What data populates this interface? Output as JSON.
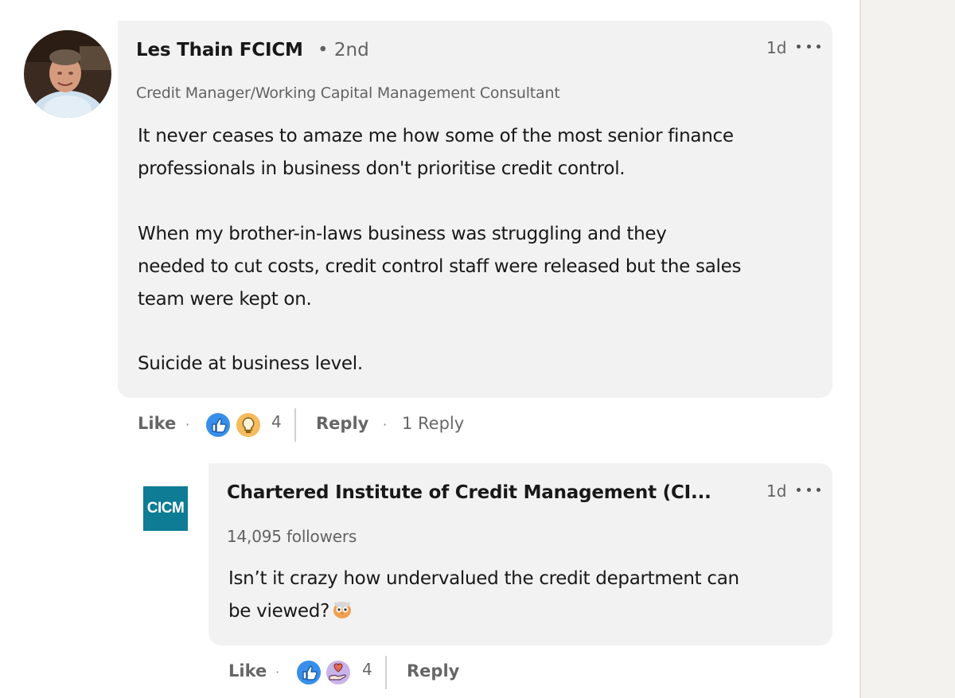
{
  "comment": {
    "author": "Les Thain FCICM",
    "degree": "• 2nd",
    "headline": "Credit Manager/Working Capital Management Consultant",
    "time": "1d",
    "paragraphs": [
      "It never ceases to amaze me how some of the most senior finance",
      "professionals in business don't prioritise credit control.",
      "When my brother-in-laws business was struggling and they",
      "needed to cut costs, credit control staff were released but the sales",
      "team were kept on.",
      "Suicide at business level."
    ],
    "actions": {
      "like": "Like",
      "reaction_count": "4",
      "reply": "Reply",
      "replies": "1 Reply"
    }
  },
  "reply": {
    "author": "Chartered Institute of Credit Management (CI...",
    "logo_text": "CICM",
    "followers": "14,095 followers",
    "time": "1d",
    "lines": [
      "Isn’t it crazy how undervalued the credit department can",
      "be viewed?"
    ],
    "actions": {
      "like": "Like",
      "reaction_count": "4",
      "reply": "Reply"
    }
  },
  "icons": {
    "like_reaction": "thumbs-up-icon",
    "insightful_reaction": "lightbulb-icon",
    "support_reaction": "heart-hand-icon",
    "more": "more-dots-icon",
    "owl_emoji": "owl-emoji-icon"
  },
  "colors": {
    "bubble": "#f2f2f2",
    "like_blue": "#378fe9",
    "insight_yellow": "#f5bb5c",
    "support_purple": "#c9b3e8",
    "cicm_teal": "#0e7c95"
  }
}
